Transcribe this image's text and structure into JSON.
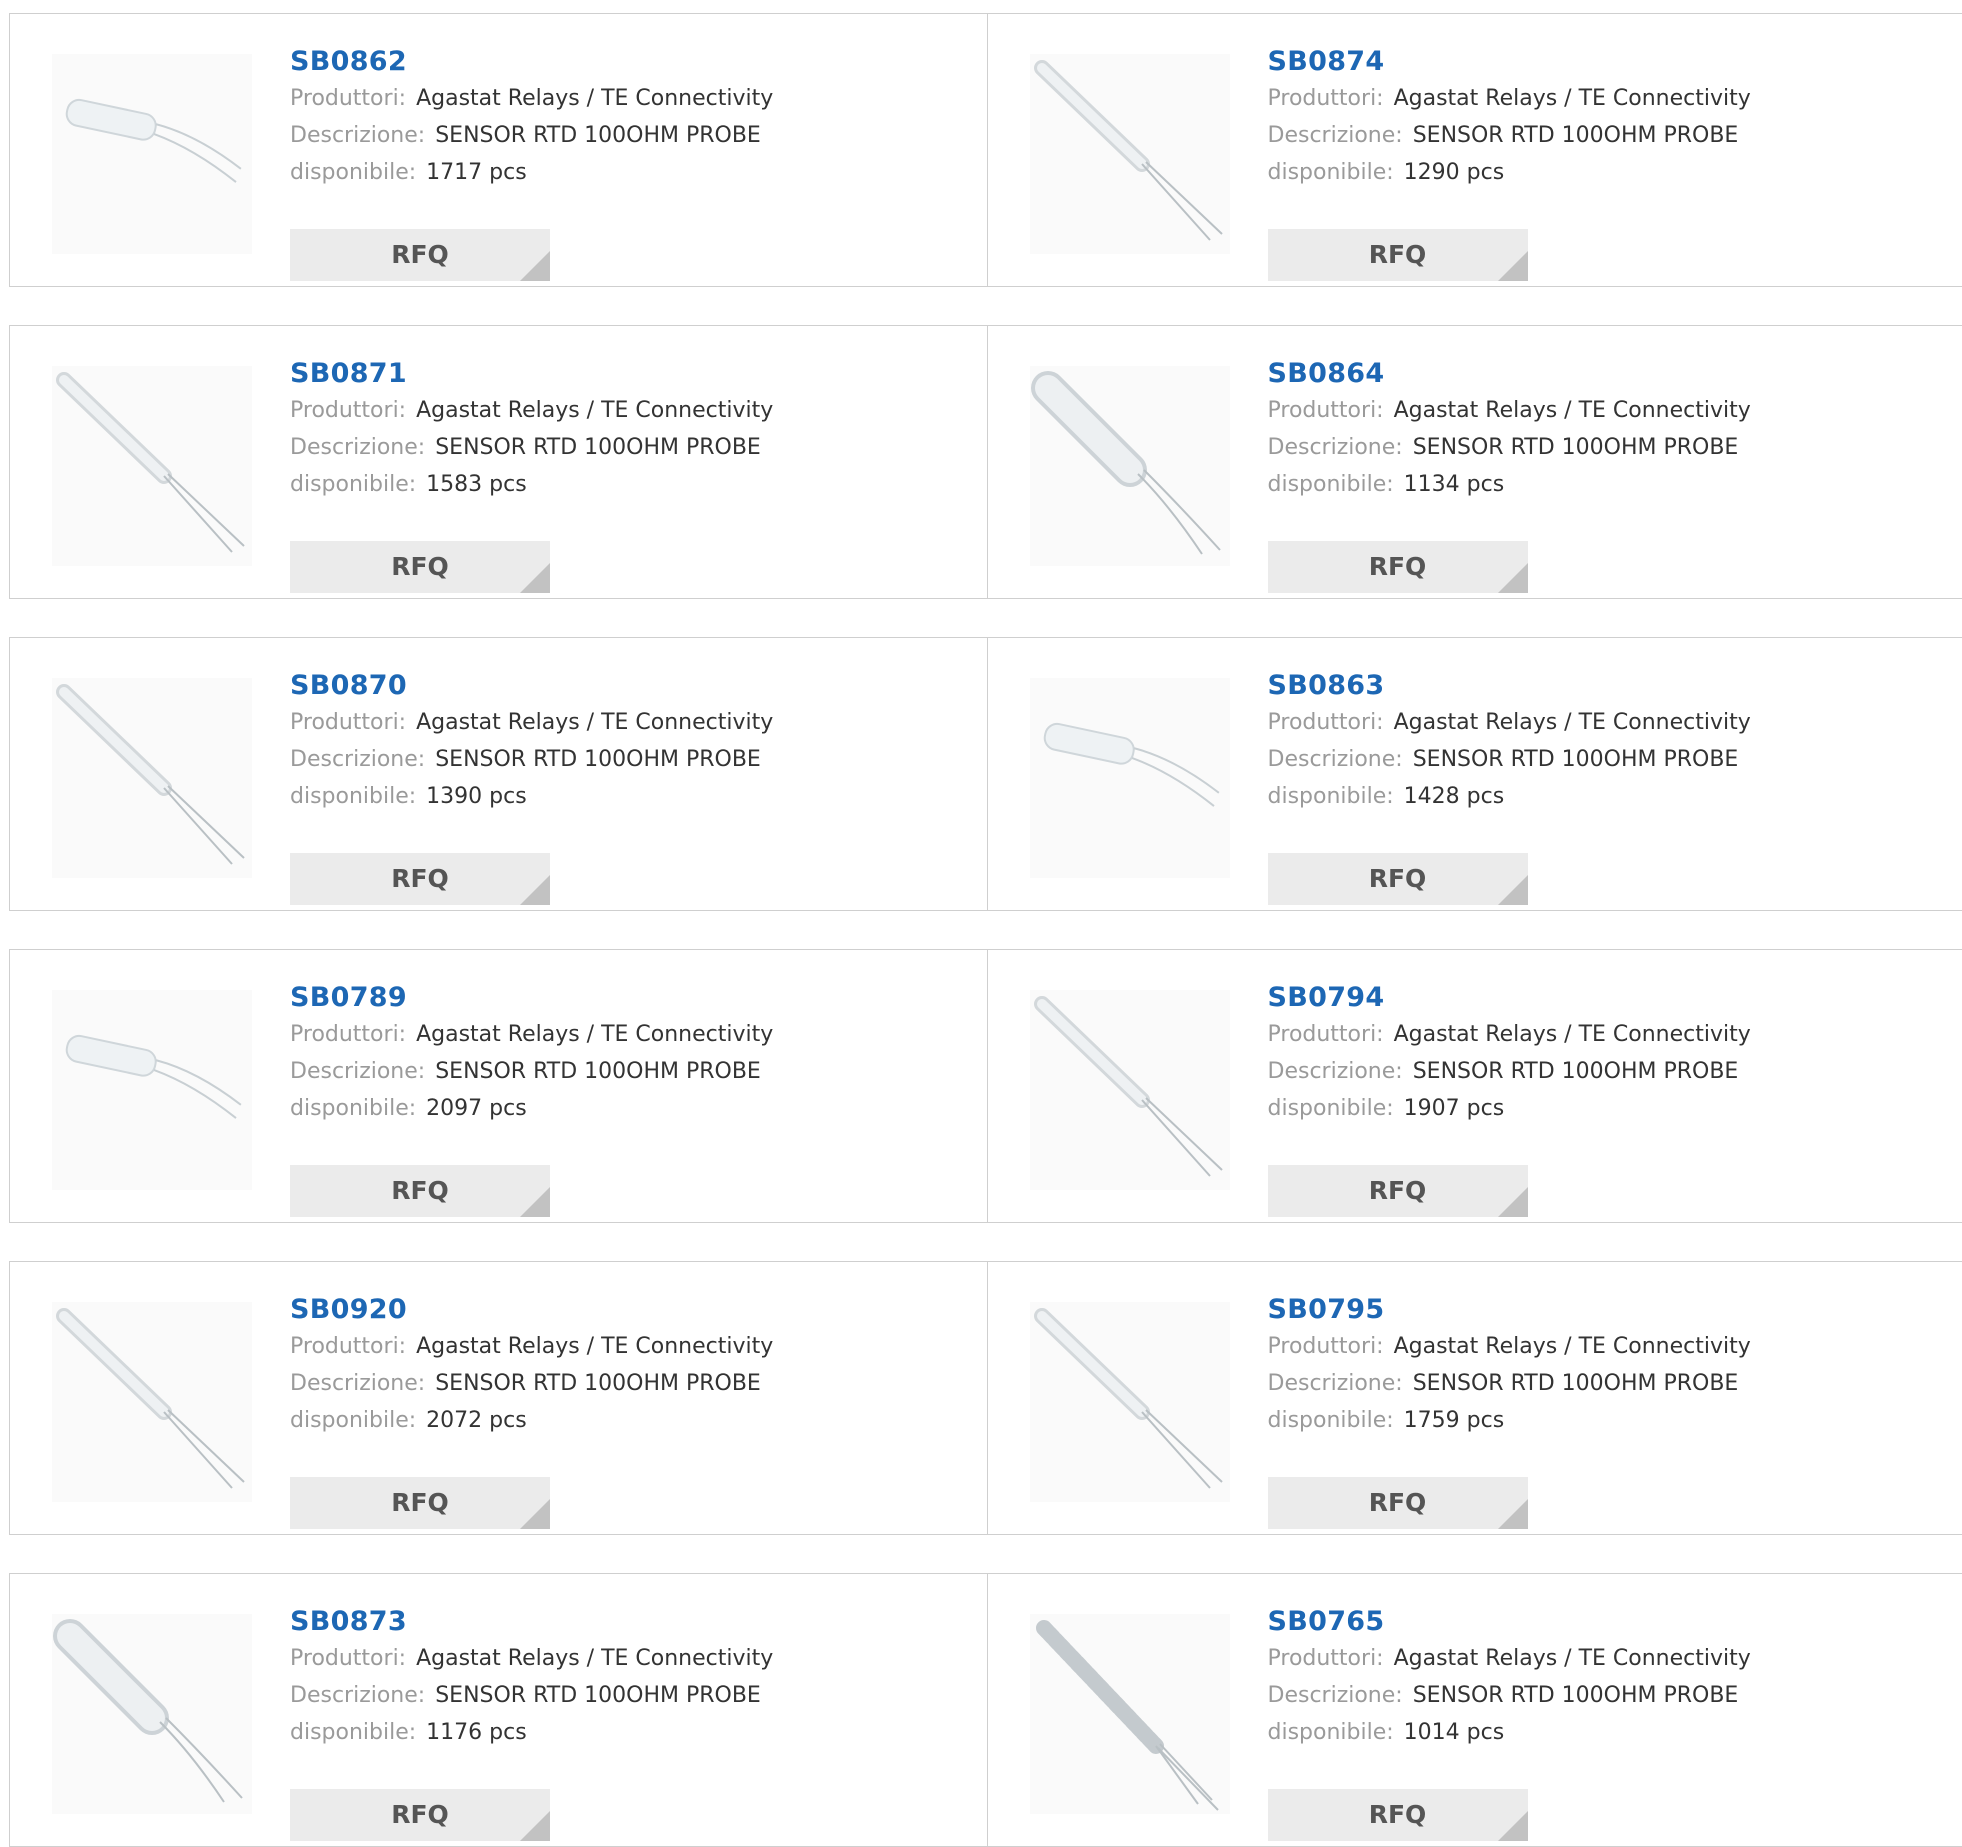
{
  "labels": {
    "manufacturer": "Produttori:",
    "description": "Descrizione:",
    "available": "disponibile:"
  },
  "rfq_label": "RFQ",
  "products": [
    {
      "part": "SB0862",
      "manufacturer": "Agastat Relays / TE Connectivity",
      "description": "SENSOR RTD 100OHM PROBE",
      "available": "1717 pcs",
      "image_icon": "short-probe-icon"
    },
    {
      "part": "SB0874",
      "manufacturer": "Agastat Relays / TE Connectivity",
      "description": "SENSOR RTD 100OHM PROBE",
      "available": "1290 pcs",
      "image_icon": "long-probe-icon"
    },
    {
      "part": "SB0871",
      "manufacturer": "Agastat Relays / TE Connectivity",
      "description": "SENSOR RTD 100OHM PROBE",
      "available": "1583 pcs",
      "image_icon": "long-probe-icon"
    },
    {
      "part": "SB0864",
      "manufacturer": "Agastat Relays / TE Connectivity",
      "description": "SENSOR RTD 100OHM PROBE",
      "available": "1134 pcs",
      "image_icon": "thick-probe-icon"
    },
    {
      "part": "SB0870",
      "manufacturer": "Agastat Relays / TE Connectivity",
      "description": "SENSOR RTD 100OHM PROBE",
      "available": "1390 pcs",
      "image_icon": "long-probe-icon"
    },
    {
      "part": "SB0863",
      "manufacturer": "Agastat Relays / TE Connectivity",
      "description": "SENSOR RTD 100OHM PROBE",
      "available": "1428 pcs",
      "image_icon": "short-probe-icon"
    },
    {
      "part": "SB0789",
      "manufacturer": "Agastat Relays / TE Connectivity",
      "description": "SENSOR RTD 100OHM PROBE",
      "available": "2097 pcs",
      "image_icon": "short-probe-icon"
    },
    {
      "part": "SB0794",
      "manufacturer": "Agastat Relays / TE Connectivity",
      "description": "SENSOR RTD 100OHM PROBE",
      "available": "1907 pcs",
      "image_icon": "long-probe-icon"
    },
    {
      "part": "SB0920",
      "manufacturer": "Agastat Relays / TE Connectivity",
      "description": "SENSOR RTD 100OHM PROBE",
      "available": "2072 pcs",
      "image_icon": "long-probe-icon"
    },
    {
      "part": "SB0795",
      "manufacturer": "Agastat Relays / TE Connectivity",
      "description": "SENSOR RTD 100OHM PROBE",
      "available": "1759 pcs",
      "image_icon": "long-probe-icon"
    },
    {
      "part": "SB0873",
      "manufacturer": "Agastat Relays / TE Connectivity",
      "description": "SENSOR RTD 100OHM PROBE",
      "available": "1176 pcs",
      "image_icon": "thick-probe-icon"
    },
    {
      "part": "SB0765",
      "manufacturer": "Agastat Relays / TE Connectivity",
      "description": "SENSOR RTD 100OHM PROBE",
      "available": "1014 pcs",
      "image_icon": "ribbed-probe-icon"
    }
  ]
}
